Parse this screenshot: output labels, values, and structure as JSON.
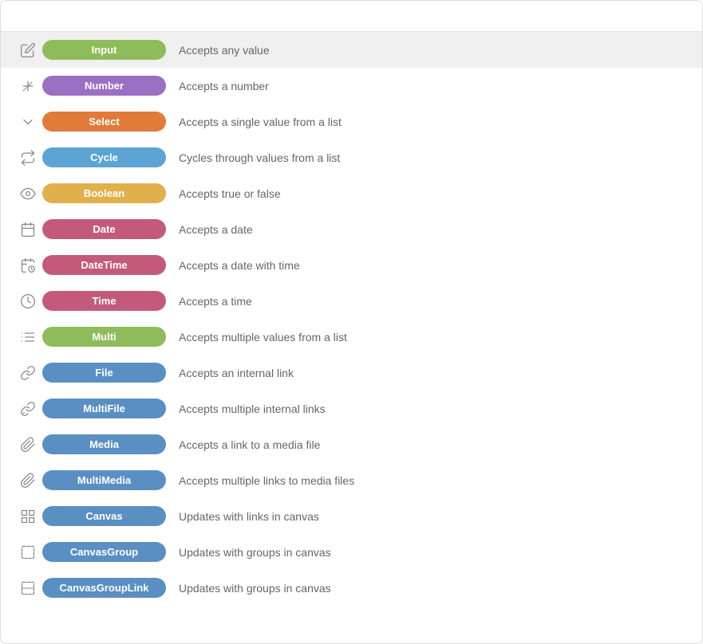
{
  "search": {
    "placeholder": "",
    "value": ""
  },
  "items": [
    {
      "id": "input",
      "badge_label": "Input",
      "badge_class": "badge-green",
      "description": "Accepts any value",
      "icon": "edit"
    },
    {
      "id": "number",
      "badge_label": "Number",
      "badge_class": "badge-purple",
      "description": "Accepts a number",
      "icon": "plus-minus"
    },
    {
      "id": "select",
      "badge_label": "Select",
      "badge_class": "badge-orange",
      "description": "Accepts a single value from a list",
      "icon": "chevron-down"
    },
    {
      "id": "cycle",
      "badge_label": "Cycle",
      "badge_class": "badge-blue",
      "description": "Cycles through values from a list",
      "icon": "cycle"
    },
    {
      "id": "boolean",
      "badge_label": "Boolean",
      "badge_class": "badge-yellow",
      "description": "Accepts true or false",
      "icon": "eye"
    },
    {
      "id": "date",
      "badge_label": "Date",
      "badge_class": "badge-pink",
      "description": "Accepts a date",
      "icon": "calendar"
    },
    {
      "id": "datetime",
      "badge_label": "DateTime",
      "badge_class": "badge-pink2",
      "description": "Accepts a date with time",
      "icon": "calendar-clock"
    },
    {
      "id": "time",
      "badge_label": "Time",
      "badge_class": "badge-pink3",
      "description": "Accepts a time",
      "icon": "clock"
    },
    {
      "id": "multi",
      "badge_label": "Multi",
      "badge_class": "badge-green2",
      "description": "Accepts multiple values from a list",
      "icon": "list"
    },
    {
      "id": "file",
      "badge_label": "File",
      "badge_class": "badge-steel",
      "description": "Accepts an internal link",
      "icon": "link"
    },
    {
      "id": "multifile",
      "badge_label": "MultiFile",
      "badge_class": "badge-steel2",
      "description": "Accepts multiple internal links",
      "icon": "link2"
    },
    {
      "id": "media",
      "badge_label": "Media",
      "badge_class": "badge-steel3",
      "description": "Accepts a link to a media file",
      "icon": "paperclip"
    },
    {
      "id": "multimedia",
      "badge_label": "MultiMedia",
      "badge_class": "badge-steel4",
      "description": "Accepts multiple links to media files",
      "icon": "paperclip2"
    },
    {
      "id": "canvas",
      "badge_label": "Canvas",
      "badge_class": "badge-steel5",
      "description": "Updates with links in canvas",
      "icon": "grid"
    },
    {
      "id": "canvasgroup",
      "badge_label": "CanvasGroup",
      "badge_class": "badge-steel6",
      "description": "Updates with groups in canvas",
      "icon": "dashed-rect"
    },
    {
      "id": "canvasgrouplink",
      "badge_label": "CanvasGroupLink",
      "badge_class": "badge-steel7",
      "description": "Updates with groups in canvas",
      "icon": "dashed-rect2"
    }
  ]
}
